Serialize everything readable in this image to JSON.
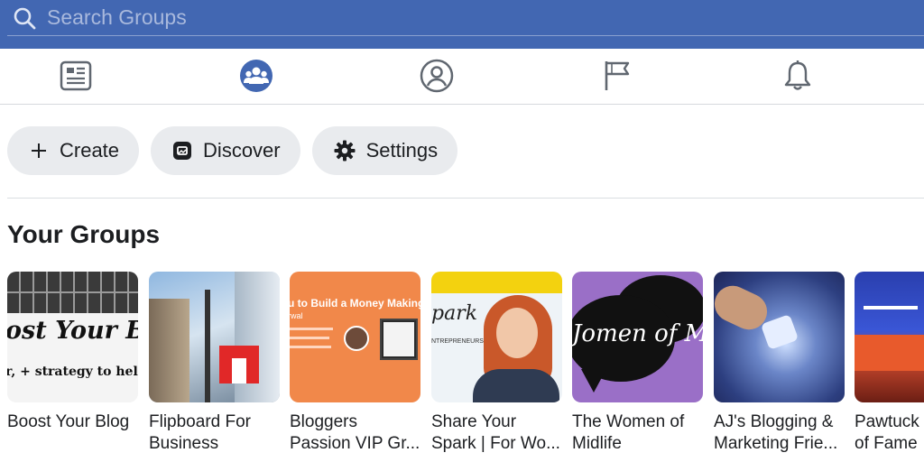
{
  "search": {
    "placeholder": "Search Groups",
    "icon": "search-icon"
  },
  "tabs": [
    {
      "name": "news-feed",
      "icon": "news-feed-icon",
      "active": false
    },
    {
      "name": "groups",
      "icon": "groups-icon",
      "active": true
    },
    {
      "name": "profile",
      "icon": "profile-icon",
      "active": false
    },
    {
      "name": "pages",
      "icon": "flag-icon",
      "active": false
    },
    {
      "name": "notifications",
      "icon": "bell-icon",
      "active": false
    }
  ],
  "actions": {
    "create_label": "Create",
    "discover_label": "Discover",
    "settings_label": "Settings"
  },
  "section": {
    "title": "Your Groups"
  },
  "groups": [
    {
      "line1": "Boost Your Blog",
      "line2": "",
      "thumb_text": "ost Your B",
      "thumb_subtext": "r, + strategy to help"
    },
    {
      "line1": "Flipboard For",
      "line2": "Business",
      "thumb_text": "",
      "thumb_subtext": ""
    },
    {
      "line1": "Bloggers",
      "line2": "Passion VIP Gr...",
      "thumb_text": "u to Build a Money Making",
      "thumb_subtext": "rwal"
    },
    {
      "line1": "Share Your",
      "line2": "Spark | For Wo...",
      "thumb_text": "park",
      "thumb_subtext": "NTREPRENEURS"
    },
    {
      "line1": "The Women of",
      "line2": "Midlife",
      "thumb_text": "Jomen of M",
      "thumb_subtext": ""
    },
    {
      "line1": "AJ's Blogging &",
      "line2": "Marketing Frie...",
      "thumb_text": "",
      "thumb_subtext": ""
    },
    {
      "line1": "Pawtuck",
      "line2": "of Fame",
      "thumb_text": "",
      "thumb_subtext": ""
    }
  ],
  "colors": {
    "brand": "#4267b2",
    "pill_bg": "#e9ebee",
    "text": "#1c1e21"
  }
}
